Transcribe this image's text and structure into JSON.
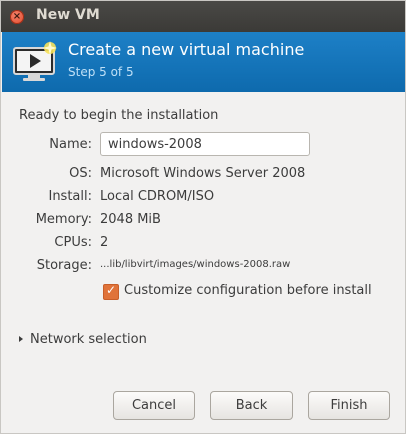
{
  "window": {
    "title": "New VM",
    "close_glyph": "×"
  },
  "header": {
    "icon": "monitor-play-icon",
    "title": "Create a new virtual machine",
    "step": "Step 5 of 5"
  },
  "summary": {
    "heading": "Ready to begin the installation",
    "name_label": "Name:",
    "name_value": "windows-2008",
    "os_label": "OS:",
    "os_value": "Microsoft Windows Server 2008",
    "install_label": "Install:",
    "install_value": "Local CDROM/ISO",
    "memory_label": "Memory:",
    "memory_value": "2048 MiB",
    "cpus_label": "CPUs:",
    "cpus_value": "2",
    "storage_label": "Storage:",
    "storage_value": "...lib/libvirt/images/windows-2008.raw"
  },
  "customize": {
    "checked": true,
    "check_glyph": "✓",
    "label": "Customize configuration before install"
  },
  "network": {
    "label": "Network selection",
    "expanded": false
  },
  "buttons": {
    "cancel": "Cancel",
    "back": "Back",
    "finish": "Finish"
  },
  "colors": {
    "header_blue": "#1578bf",
    "checkbox_orange": "#e0733a",
    "titlebar": "#3c3b37"
  }
}
